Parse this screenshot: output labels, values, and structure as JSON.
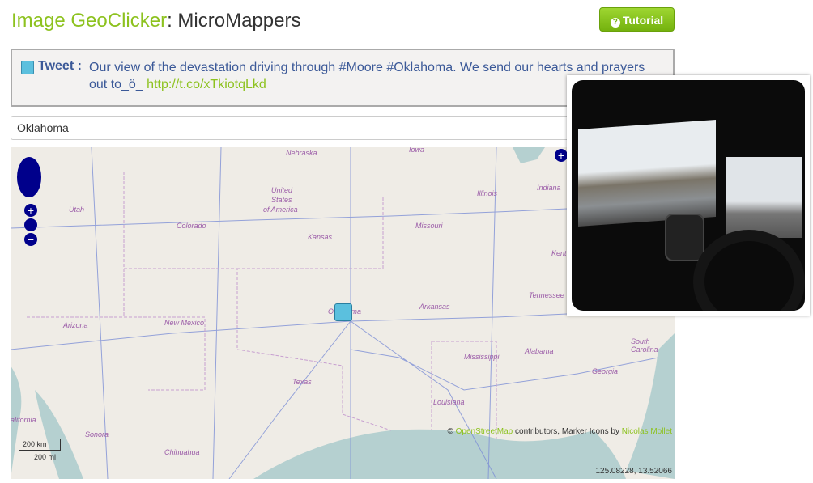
{
  "header": {
    "title_app": "Image GeoClicker",
    "title_sep": ": ",
    "title_project": "MicroMappers",
    "tutorial_label": "Tutorial"
  },
  "tweet": {
    "label": "Tweet :",
    "text": "Our view of the devastation driving through #Moore #Oklahoma. We send our hearts and prayers out to_ö_ ",
    "link": "http://t.co/xTkiotqLkd"
  },
  "search": {
    "value": "Oklahoma"
  },
  "map": {
    "labels": [
      "Nebraska",
      "Iowa",
      "Illinois",
      "Indiana",
      "United",
      "States",
      "of America",
      "Utah",
      "Colorado",
      "Kansas",
      "Missouri",
      "Kent",
      "Arizona",
      "New Mexico",
      "Oklahoma",
      "Arkansas",
      "Tennessee",
      "Texas",
      "Mississippi",
      "Alabama",
      "Georgia",
      "South Carolina",
      "Louisiana",
      "Sonora",
      "Chihuahua",
      "alifornia"
    ],
    "attribution_prefix": "© ",
    "attribution_osm": "OpenStreetMap",
    "attribution_mid": " contributors, Marker Icons by ",
    "attribution_author": "Nicolas Mollet",
    "coordinates": "125.08228, 13.52066",
    "scale_km": "200 km",
    "scale_mi": "200 mi",
    "zoom_in": "+",
    "zoom_out": "−"
  },
  "colors": {
    "accent": "#8dc21f",
    "tweet_text": "#3b5998",
    "water": "#b5d0d0",
    "land": "#efece6",
    "nav": "#00008b"
  }
}
